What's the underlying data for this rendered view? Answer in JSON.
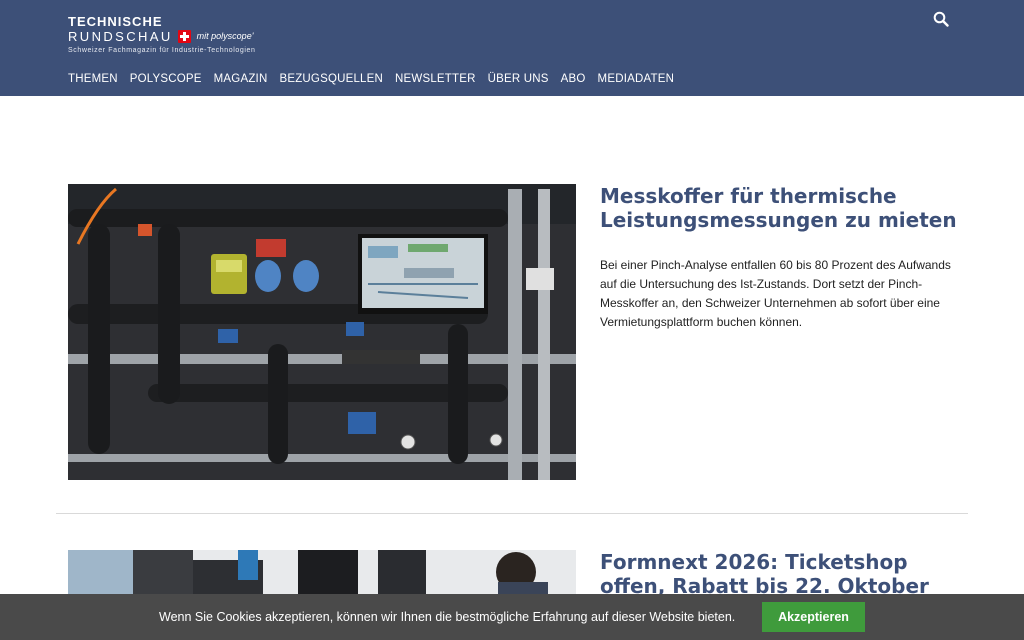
{
  "header": {
    "logo_line1": "TECHNISCHE",
    "logo_line2": "RUNDSCHAU",
    "logo_partner": "mit polyscope'",
    "logo_tagline": "Schweizer Fachmagazin für Industrie-Technologien",
    "colors": {
      "background": "#3d5078",
      "swiss_red": "#e30613"
    }
  },
  "nav": {
    "items": [
      {
        "label": "THEMEN"
      },
      {
        "label": "POLYSCOPE"
      },
      {
        "label": "MAGAZIN"
      },
      {
        "label": "BEZUGSQUELLEN"
      },
      {
        "label": "NEWSLETTER"
      },
      {
        "label": "ÜBER UNS"
      },
      {
        "label": "ABO"
      },
      {
        "label": "MEDIADATEN"
      }
    ]
  },
  "articles": [
    {
      "title": "Messkoffer für thermische Leistungsmessungen zu mieten",
      "excerpt": "Bei einer Pinch-Analyse entfallen 60 bis 80 Prozent des Aufwands auf die Untersuchung des Ist-Zustands. Dort setzt der Pinch-Messkoffer an, den Schweizer Unternehmen ab sofort über eine Vermietungsplattform buchen können."
    },
    {
      "title": "Formnext 2026: Ticketshop offen, Rabatt bis 22. Oktober",
      "excerpt": ""
    }
  ],
  "cookie": {
    "text": "Wenn Sie Cookies akzeptieren, können wir Ihnen die bestmögliche Erfahrung auf dieser Website bieten.",
    "button": "Akzeptieren",
    "colors": {
      "bar": "#4a4a4a",
      "button": "#3f9b3c"
    }
  }
}
